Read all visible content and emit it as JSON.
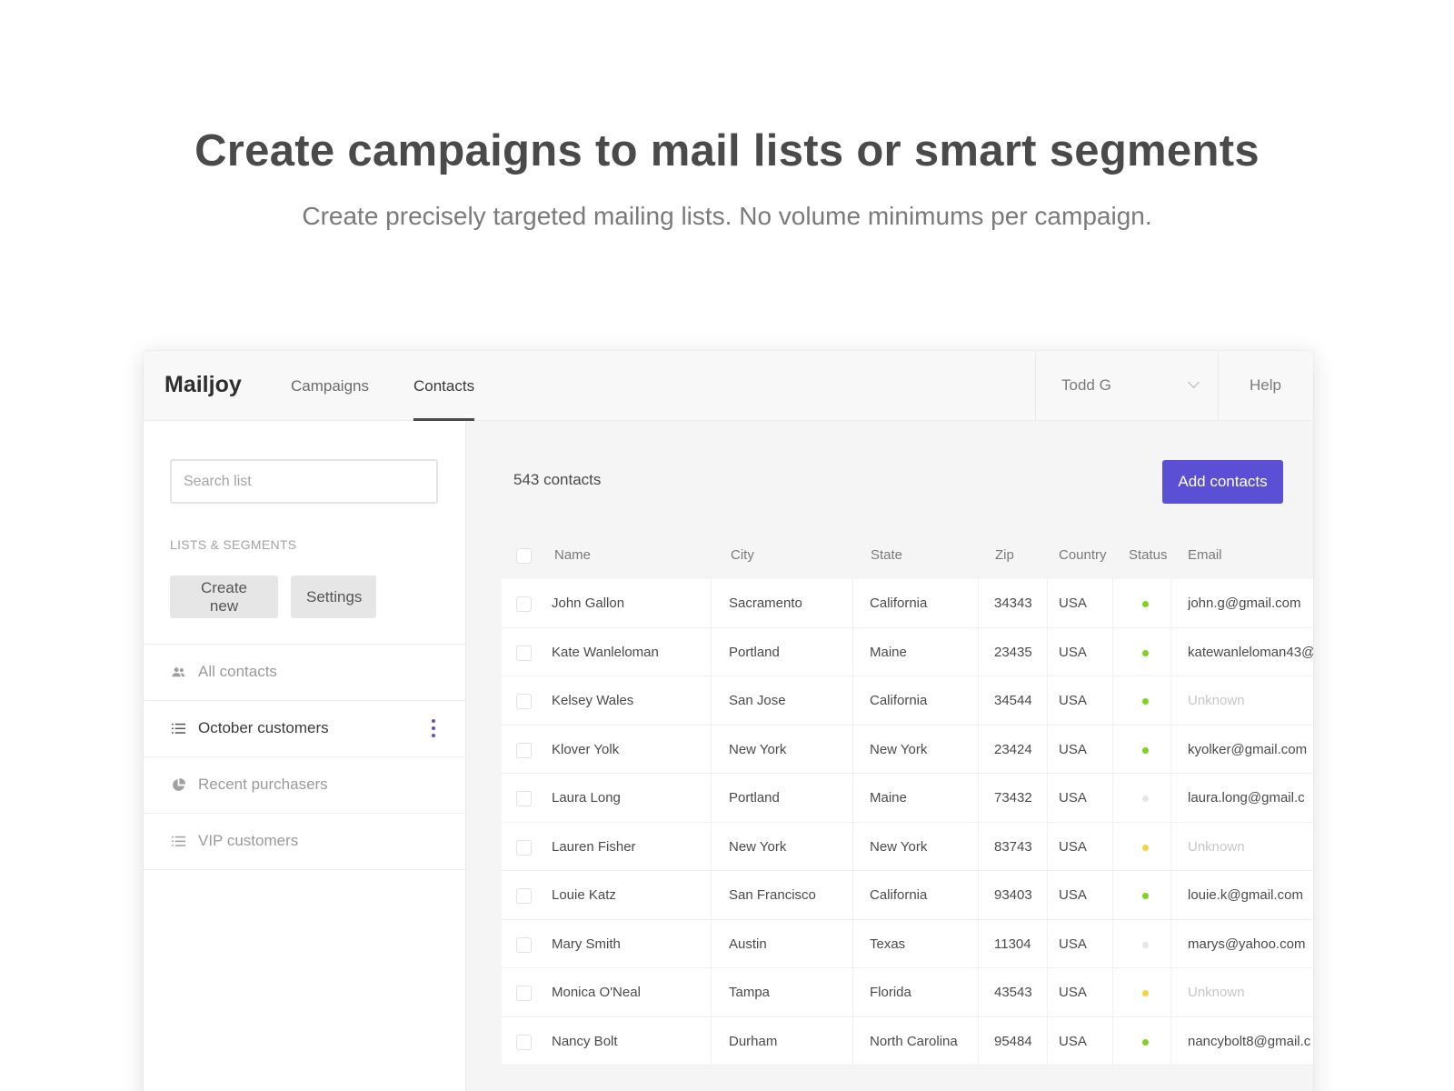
{
  "hero": {
    "title": "Create campaigns to mail lists or smart segments",
    "subtitle": "Create precisely targeted mailing lists. No volume minimums per campaign."
  },
  "app": {
    "logo": "Mailjoy",
    "nav": [
      "Campaigns",
      "Contacts"
    ],
    "active_nav": "Contacts",
    "user": "Todd G",
    "help": "Help"
  },
  "sidebar": {
    "search_placeholder": "Search list",
    "section_label": "LISTS & SEGMENTS",
    "create_label": "Create new",
    "settings_label": "Settings",
    "items": [
      {
        "label": "All contacts",
        "icon": "people-icon",
        "active": false
      },
      {
        "label": "October customers",
        "icon": "list-icon",
        "active": true
      },
      {
        "label": "Recent purchasers",
        "icon": "pie-icon",
        "active": false
      },
      {
        "label": "VIP customers",
        "icon": "list-icon",
        "active": false
      }
    ]
  },
  "main": {
    "count_label": "543 contacts",
    "add_label": "Add contacts",
    "columns": [
      "Name",
      "City",
      "State",
      "Zip",
      "Country",
      "Status",
      "Email"
    ],
    "rows": [
      {
        "name": "John Gallon",
        "city": "Sacramento",
        "state": "California",
        "zip": "34343",
        "country": "USA",
        "status": "green",
        "email": "john.g@gmail.com"
      },
      {
        "name": "Kate Wanleloman",
        "city": "Portland",
        "state": "Maine",
        "zip": "23435",
        "country": "USA",
        "status": "green",
        "email": "katewanleloman43@"
      },
      {
        "name": "Kelsey Wales",
        "city": "San Jose",
        "state": "California",
        "zip": "34544",
        "country": "USA",
        "status": "green",
        "email": "Unknown"
      },
      {
        "name": "Klover Yolk",
        "city": "New York",
        "state": "New York",
        "zip": "23424",
        "country": "USA",
        "status": "green",
        "email": "kyolker@gmail.com"
      },
      {
        "name": "Laura Long",
        "city": "Portland",
        "state": "Maine",
        "zip": "73432",
        "country": "USA",
        "status": "gray",
        "email": "laura.long@gmail.c"
      },
      {
        "name": "Lauren Fisher",
        "city": "New York",
        "state": "New York",
        "zip": "83743",
        "country": "USA",
        "status": "yellow",
        "email": "Unknown"
      },
      {
        "name": "Louie Katz",
        "city": "San Francisco",
        "state": "California",
        "zip": "93403",
        "country": "USA",
        "status": "green",
        "email": "louie.k@gmail.com"
      },
      {
        "name": "Mary Smith",
        "city": "Austin",
        "state": "Texas",
        "zip": "11304",
        "country": "USA",
        "status": "gray",
        "email": "marys@yahoo.com"
      },
      {
        "name": "Monica O'Neal",
        "city": "Tampa",
        "state": "Florida",
        "zip": "43543",
        "country": "USA",
        "status": "yellow",
        "email": "Unknown"
      },
      {
        "name": "Nancy Bolt",
        "city": "Durham",
        "state": "North Carolina",
        "zip": "95484",
        "country": "USA",
        "status": "green",
        "email": "nancybolt8@gmail.c"
      }
    ]
  },
  "colors": {
    "accent": "#5b4fd6",
    "status_green": "#7ed321",
    "status_yellow": "#f5d33b",
    "status_gray": "#e6e6e6"
  }
}
